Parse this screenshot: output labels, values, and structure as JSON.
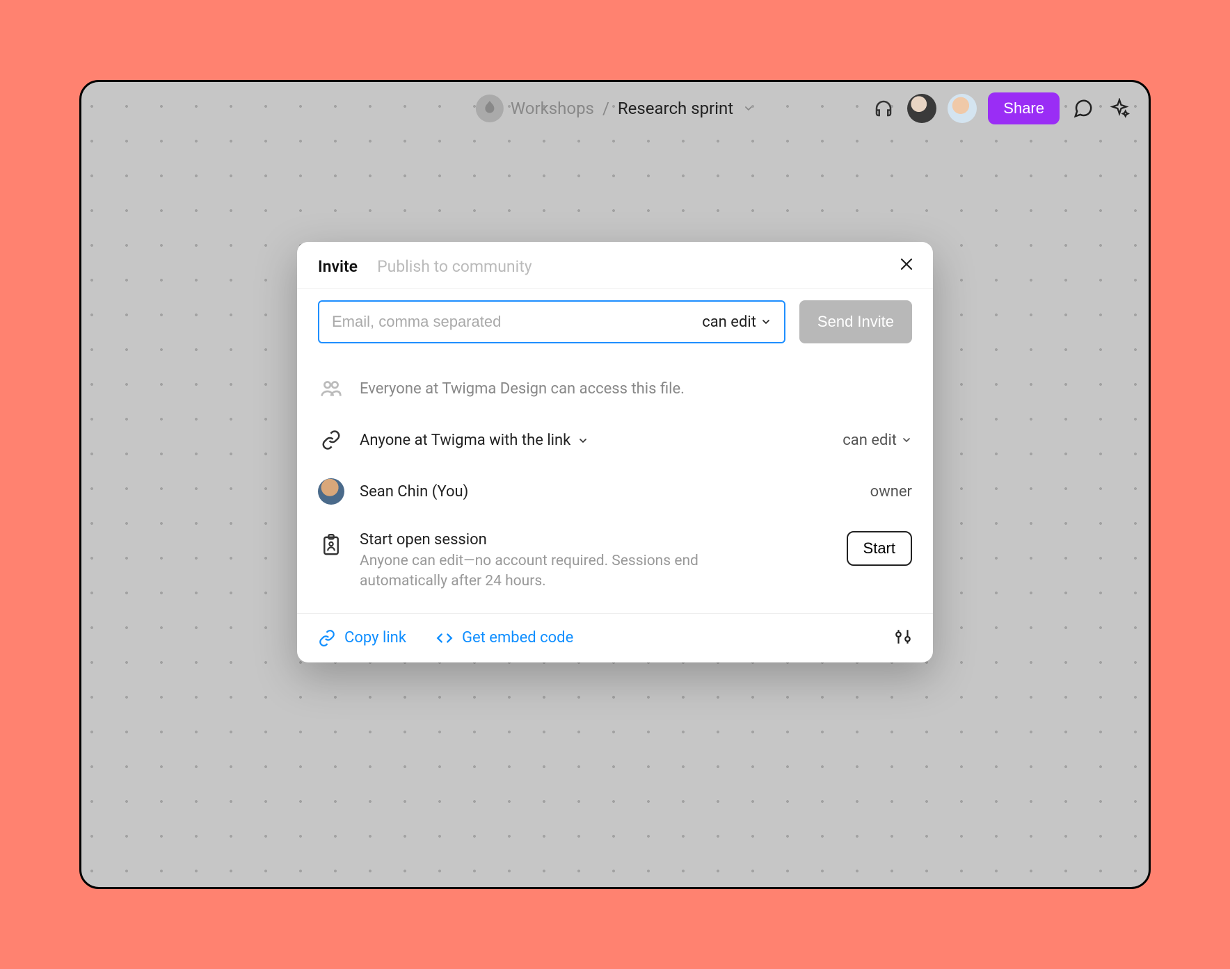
{
  "header": {
    "team": "Workshops",
    "slash": "/",
    "file": "Research sprint",
    "share_label": "Share"
  },
  "modal": {
    "tabs": {
      "invite": "Invite",
      "publish": "Publish to community"
    },
    "email_placeholder": "Email, comma separated",
    "perm_can_edit": "can edit",
    "send_label": "Send Invite",
    "org_access": "Everyone at Twigma Design can access this file.",
    "link_access": "Anyone at Twigma with the link",
    "link_perm": "can edit",
    "owner_name": "Sean Chin (You)",
    "owner_role": "owner",
    "session_title": "Start open session",
    "session_sub": "Anyone can edit—no account required. Sessions end automatically after 24 hours.",
    "start_label": "Start",
    "copy_link": "Copy link",
    "embed_code": "Get embed code"
  },
  "colors": {
    "accent": "#9a2df5",
    "link": "#0f8eff",
    "focus": "#1f8fff"
  }
}
